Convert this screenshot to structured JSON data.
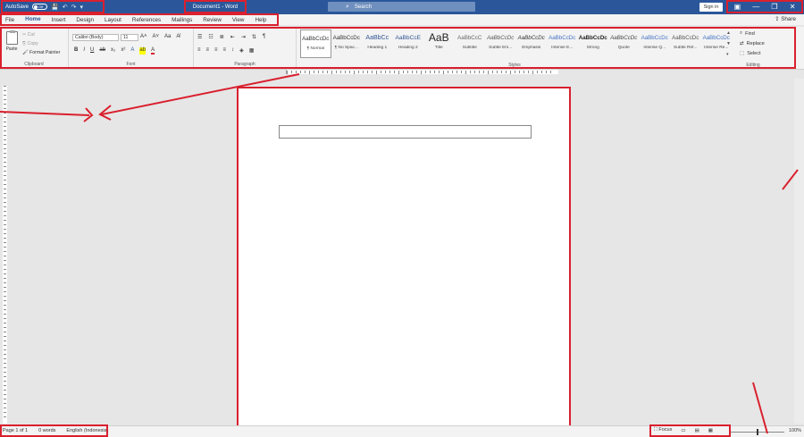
{
  "titlebar": {
    "autosave_label": "AutoSave",
    "autosave_state": "Off",
    "doc_title": "Document1 - Word",
    "search_placeholder": "Search",
    "signin_label": "Sign in",
    "minimize": "—",
    "restore": "❐",
    "close": "✕"
  },
  "menu": {
    "tabs": [
      "File",
      "Home",
      "Insert",
      "Design",
      "Layout",
      "References",
      "Mailings",
      "Review",
      "View",
      "Help"
    ],
    "active": "Home",
    "share_label": "Share"
  },
  "ribbon": {
    "clipboard": {
      "paste": "Paste",
      "cut": "Cut",
      "copy": "Copy",
      "format_painter": "Format Painter",
      "label": "Clipboard"
    },
    "font": {
      "name": "Calibri (Body)",
      "size": "11",
      "label": "Font"
    },
    "paragraph": {
      "label": "Paragraph"
    },
    "styles": {
      "label": "Styles",
      "items": [
        {
          "sample": "AaBbCcDc",
          "name": "¶ Normal"
        },
        {
          "sample": "AaBbCcDc",
          "name": "¶ No Spac..."
        },
        {
          "sample": "AaBbCc",
          "name": "Heading 1"
        },
        {
          "sample": "AaBbCcE",
          "name": "Heading 2"
        },
        {
          "sample": "AaB",
          "name": "Title"
        },
        {
          "sample": "AaBbCcC",
          "name": "Subtitle"
        },
        {
          "sample": "AaBbCcDc",
          "name": "Subtle Em..."
        },
        {
          "sample": "AaBbCcDc",
          "name": "Emphasis"
        },
        {
          "sample": "AaBbCcDc",
          "name": "Intense E..."
        },
        {
          "sample": "AaBbCcDc",
          "name": "Strong"
        },
        {
          "sample": "AaBbCcDc",
          "name": "Quote"
        },
        {
          "sample": "AaBbCcDc",
          "name": "Intense Q..."
        },
        {
          "sample": "AaBbCcDc",
          "name": "Subtle Ref..."
        },
        {
          "sample": "AaBbCcDc",
          "name": "Intense Re..."
        }
      ]
    },
    "editing": {
      "find": "Find",
      "replace": "Replace",
      "select": "Select",
      "label": "Editing"
    }
  },
  "status": {
    "page": "Page 1 of 1",
    "words": "0 words",
    "language": "English (Indonesia)",
    "focus": "Focus",
    "zoom": "100%"
  }
}
